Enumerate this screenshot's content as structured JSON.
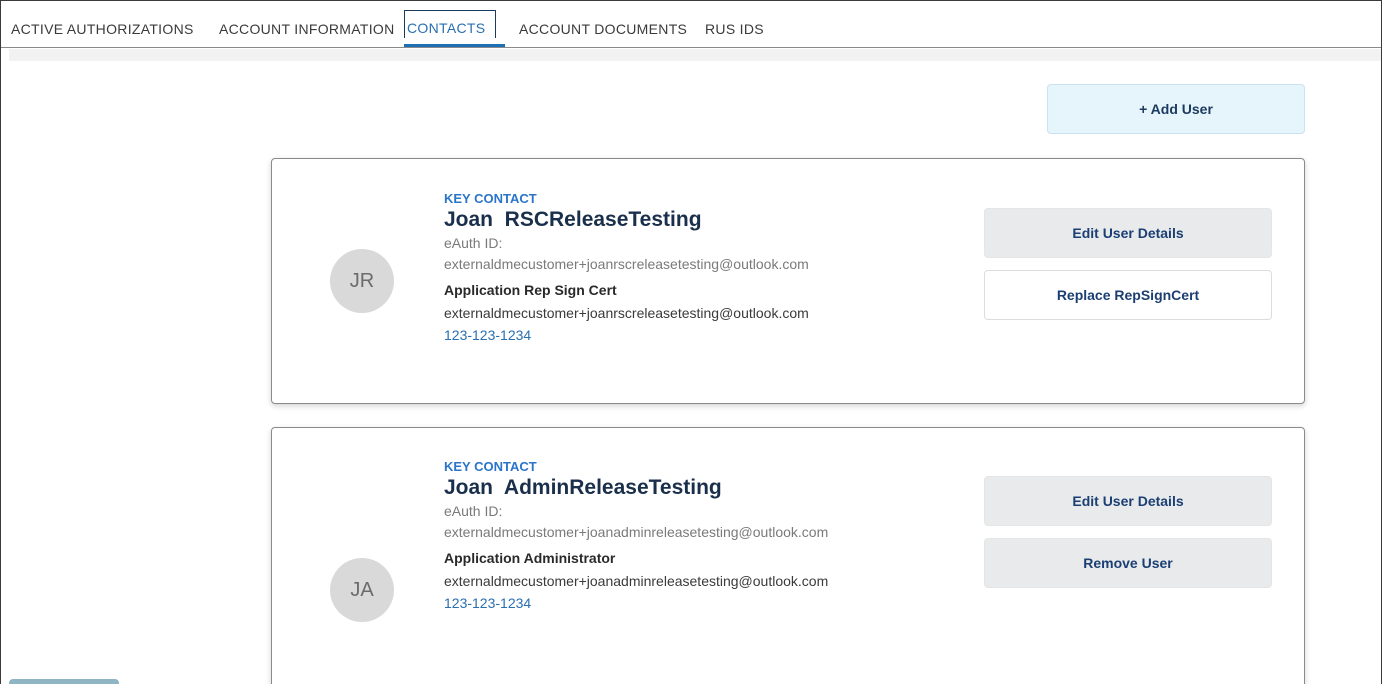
{
  "tabs": [
    {
      "label": "ACTIVE AUTHORIZATIONS"
    },
    {
      "label": "ACCOUNT INFORMATION"
    },
    {
      "label": "CONTACTS"
    },
    {
      "label": "ACCOUNT DOCUMENTS"
    },
    {
      "label": "RUS IDS"
    }
  ],
  "active_tab": "CONTACTS",
  "add_user_label": "+ Add User",
  "contacts": [
    {
      "initials": "JR",
      "tag": "KEY CONTACT",
      "name": "Joan  RSCReleaseTesting",
      "eauth_label": "eAuth ID:",
      "eauth_id": "externaldmecustomer+joanrscreleasetesting@outlook.com",
      "role": "Application Rep Sign Cert",
      "email": "externaldmecustomer+joanrscreleasetesting@outlook.com",
      "phone": "123-123-1234",
      "buttons": [
        "Edit User Details",
        "Replace RepSignCert"
      ]
    },
    {
      "initials": "JA",
      "tag": "KEY CONTACT",
      "name": "Joan  AdminReleaseTesting",
      "eauth_label": "eAuth ID:",
      "eauth_id": "externaldmecustomer+joanadminreleasetesting@outlook.com",
      "role": "Application Administrator",
      "email": "externaldmecustomer+joanadminreleasetesting@outlook.com",
      "phone": "123-123-1234",
      "buttons": [
        "Edit User Details",
        "Remove User"
      ]
    }
  ],
  "colors": {
    "accent": "#2a74c9",
    "name": "#1a2f4b",
    "button_text": "#1c3f73",
    "add_user_bg": "#e6f4fc"
  }
}
